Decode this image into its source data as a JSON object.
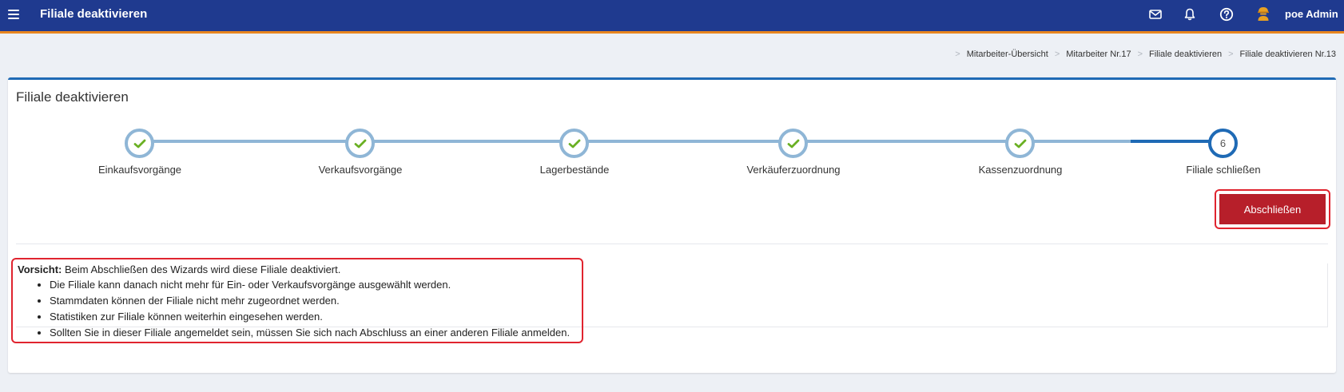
{
  "header": {
    "title": "Filiale deaktivieren",
    "user": "poe Admin",
    "icons": [
      "menu-icon",
      "mail-icon",
      "bell-icon",
      "help-icon",
      "user-avatar-icon"
    ]
  },
  "breadcrumb": [
    "Mitarbeiter-Übersicht",
    "Mitarbeiter Nr.17",
    "Filiale deaktivieren",
    "Filiale deaktivieren Nr.13"
  ],
  "card": {
    "title": "Filiale deaktivieren"
  },
  "wizard": {
    "steps": [
      {
        "label": "Einkaufsvorgänge",
        "state": "done"
      },
      {
        "label": "Verkaufsvorgänge",
        "state": "done"
      },
      {
        "label": "Lagerbestände",
        "state": "done"
      },
      {
        "label": "Verkäuferzuordnung",
        "state": "done"
      },
      {
        "label": "Kassenzuordnung",
        "state": "done"
      },
      {
        "label": "Filiale schließen",
        "state": "active",
        "number": "6"
      }
    ]
  },
  "actions": {
    "finish_label": "Abschließen"
  },
  "warning": {
    "prefix": "Vorsicht:",
    "text": " Beim Abschließen des Wizards wird diese Filiale deaktiviert.",
    "items": [
      "Die Filiale kann danach nicht mehr für Ein- oder Verkaufsvorgänge ausgewählt werden.",
      "Stammdaten können der Filiale nicht mehr zugeordnet werden.",
      "Statistiken zur Filiale können weiterhin eingesehen werden.",
      "Sollten Sie in dieser Filiale angemeldet sein, müssen Sie sich nach Abschluss an einer anderen Filiale anmelden."
    ]
  },
  "colors": {
    "header_bg": "#1f3a8f",
    "header_accent": "#e8861f",
    "step_done": "#8fb6d6",
    "step_active": "#1f6ab5",
    "check": "#6ab023",
    "finish_button": "#b71f2a",
    "highlight_border": "#e0242f"
  }
}
